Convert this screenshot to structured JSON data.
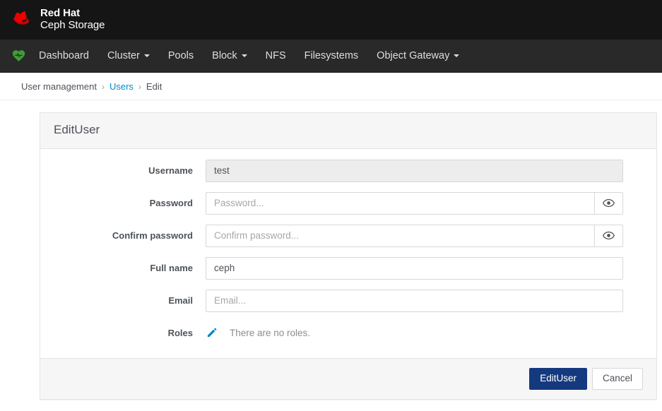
{
  "brand": {
    "line1": "Red Hat",
    "line2": "Ceph Storage",
    "logo_icon": "red-hat-fedora-icon",
    "logo_color": "#ee0000",
    "header_bg": "#151515"
  },
  "navbar": {
    "bg": "#292929",
    "health_icon": "heart-pulse-icon",
    "health_icon_color": "#3f9c35",
    "items": [
      {
        "label": "Dashboard",
        "has_dropdown": false
      },
      {
        "label": "Cluster",
        "has_dropdown": true
      },
      {
        "label": "Pools",
        "has_dropdown": false
      },
      {
        "label": "Block",
        "has_dropdown": true
      },
      {
        "label": "NFS",
        "has_dropdown": false
      },
      {
        "label": "Filesystems",
        "has_dropdown": false
      },
      {
        "label": "Object Gateway",
        "has_dropdown": true
      }
    ]
  },
  "breadcrumb": {
    "items": [
      {
        "label": "User management",
        "is_link": false
      },
      {
        "label": "Users",
        "is_link": true
      },
      {
        "label": "Edit",
        "is_link": false
      }
    ],
    "separator": "›",
    "link_color": "#0088ce"
  },
  "card": {
    "title": "EditUser",
    "fields": {
      "username": {
        "label": "Username",
        "value": "test",
        "placeholder": "",
        "disabled": true
      },
      "password": {
        "label": "Password",
        "value": "",
        "placeholder": "Password...",
        "toggle_icon": "eye-icon"
      },
      "confirm_password": {
        "label": "Confirm password",
        "value": "",
        "placeholder": "Confirm password...",
        "toggle_icon": "eye-icon"
      },
      "full_name": {
        "label": "Full name",
        "value": "ceph",
        "placeholder": ""
      },
      "email": {
        "label": "Email",
        "value": "",
        "placeholder": "Email..."
      },
      "roles": {
        "label": "Roles",
        "edit_icon": "pencil-icon",
        "edit_icon_color": "#0088ce",
        "empty_text": "There are no roles."
      }
    },
    "footer": {
      "submit_label": "EditUser",
      "cancel_label": "Cancel",
      "submit_color": "#15397f"
    }
  }
}
